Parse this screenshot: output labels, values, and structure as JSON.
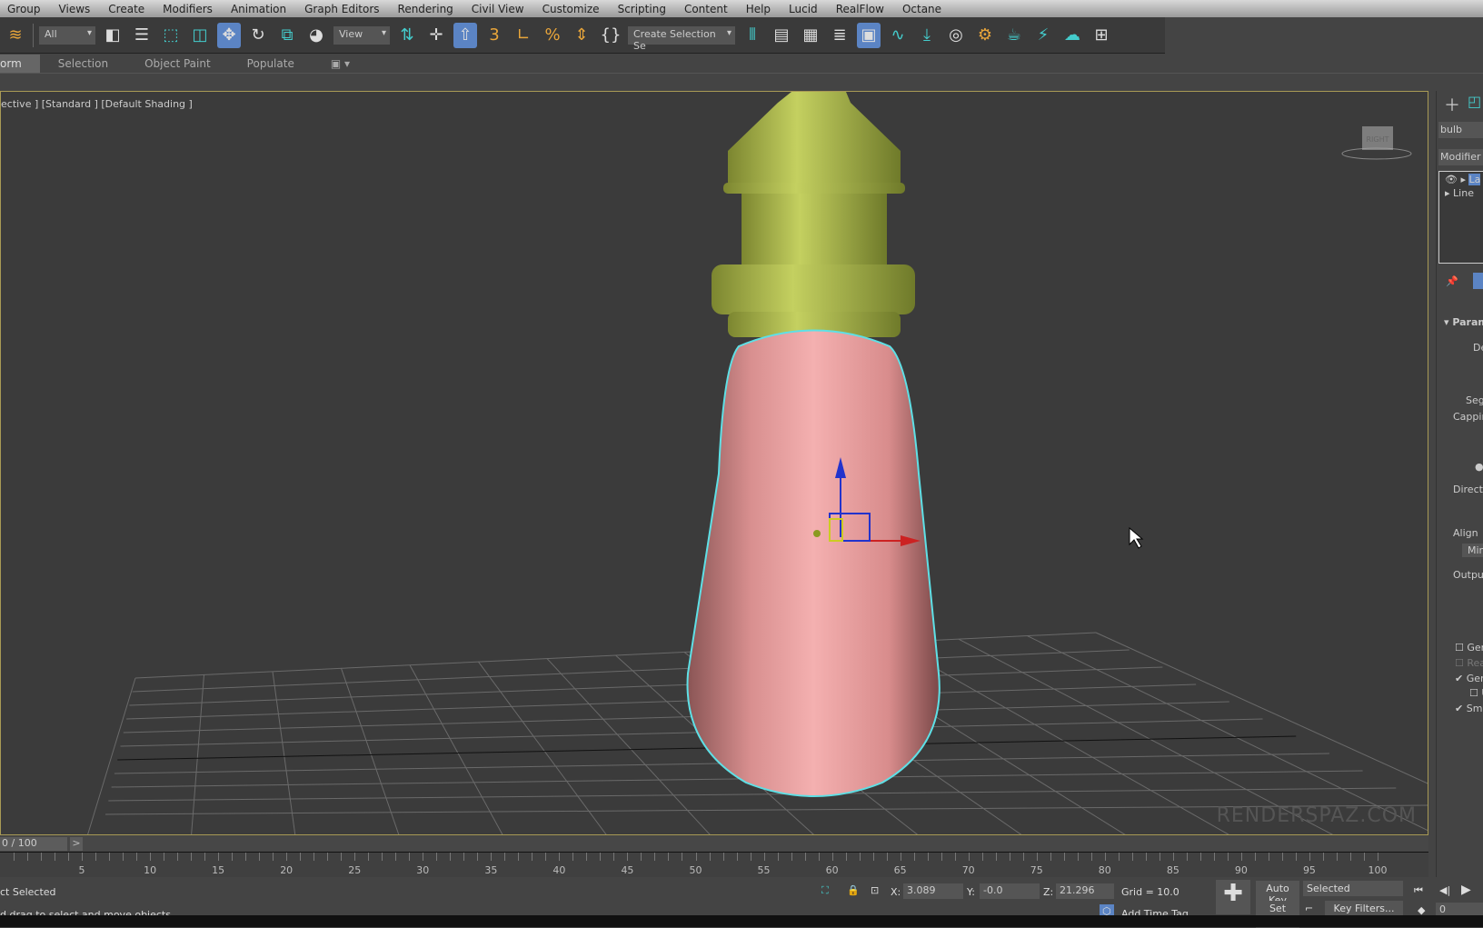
{
  "menu": [
    "Group",
    "Views",
    "Create",
    "Modifiers",
    "Animation",
    "Graph Editors",
    "Rendering",
    "Civil View",
    "Customize",
    "Scripting",
    "Content",
    "Help",
    "Lucid",
    "RealFlow",
    "Octane"
  ],
  "toolbar": {
    "filter": "All",
    "ref_coord": "View",
    "named_selection": "Create Selection Se"
  },
  "tabs": [
    "orm",
    "Selection",
    "Object Paint",
    "Populate"
  ],
  "viewport": {
    "label": "ective ] [Standard ] [Default Shading ]",
    "watermark": "RENDERSPAZ.COM",
    "viewcube": "RIGHT"
  },
  "command_panel": {
    "object_name": "bulb",
    "modifier_list": "Modifier Li",
    "stack": [
      "La",
      "Line"
    ],
    "rollout": "Param",
    "labels": [
      "De",
      "Segr",
      "Cappin",
      "Directi",
      "Align",
      "Mir",
      "Outpu",
      "Gen",
      "Rea",
      "Gen",
      "U",
      "Smo"
    ]
  },
  "timeline": {
    "frame": "0 / 100",
    "next": ">",
    "ticks": [
      "5",
      "10",
      "15",
      "20",
      "25",
      "30",
      "35",
      "40",
      "45",
      "50",
      "55",
      "60",
      "65",
      "70",
      "75",
      "80",
      "85",
      "90",
      "95",
      "100"
    ]
  },
  "status": {
    "selection": "ct Selected",
    "prompt": "d drag to select and move objects",
    "x_label": "X:",
    "x": "3.089",
    "y_label": "Y:",
    "y": "-0.0",
    "z_label": "Z:",
    "z": "21.296",
    "grid": "Grid = 10.0",
    "add_time_tag": "Add Time Tag",
    "auto_key": "Auto Key",
    "set_key": "Set Key",
    "key_mode": "Selected",
    "key_filters": "Key Filters...",
    "current_frame": "0"
  },
  "colors": {
    "bulb_glass": "#e8a0a0",
    "socket": "#b8c45a",
    "selection_outline": "#5ee0e6",
    "viewport_border": "#a89a55"
  }
}
